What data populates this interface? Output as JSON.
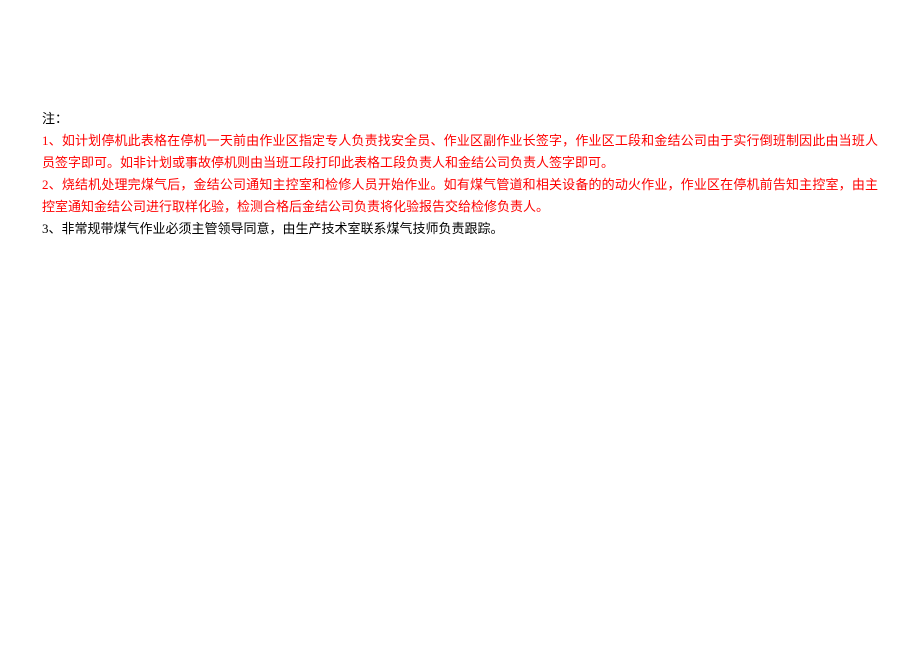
{
  "notes": {
    "heading": "注：",
    "item1": "1、如计划停机此表格在停机一天前由作业区指定专人负责找安全员、作业区副作业长签字，作业区工段和金结公司由于实行倒班制因此由当班人员签字即可。如非计划或事故停机则由当班工段打印此表格工段负责人和金结公司负责人签字即可。",
    "item2": "2、烧结机处理完煤气后，金结公司通知主控室和检修人员开始作业。如有煤气管道和相关设备的的动火作业，作业区在停机前告知主控室，由主控室通知金结公司进行取样化验，检测合格后金结公司负责将化验报告交给检修负责人。",
    "item3": "3、非常规带煤气作业必须主管领导同意，由生产技术室联系煤气技师负责跟踪。"
  }
}
